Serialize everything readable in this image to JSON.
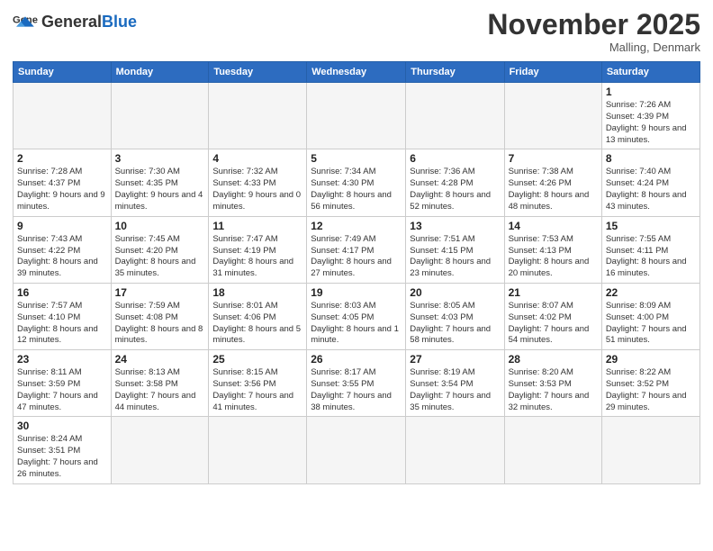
{
  "logo": {
    "general": "General",
    "blue": "Blue"
  },
  "header": {
    "month": "November 2025",
    "location": "Malling, Denmark"
  },
  "weekdays": [
    "Sunday",
    "Monday",
    "Tuesday",
    "Wednesday",
    "Thursday",
    "Friday",
    "Saturday"
  ],
  "weeks": [
    [
      {
        "day": "",
        "info": ""
      },
      {
        "day": "",
        "info": ""
      },
      {
        "day": "",
        "info": ""
      },
      {
        "day": "",
        "info": ""
      },
      {
        "day": "",
        "info": ""
      },
      {
        "day": "",
        "info": ""
      },
      {
        "day": "1",
        "info": "Sunrise: 7:26 AM\nSunset: 4:39 PM\nDaylight: 9 hours and 13 minutes."
      }
    ],
    [
      {
        "day": "2",
        "info": "Sunrise: 7:28 AM\nSunset: 4:37 PM\nDaylight: 9 hours and 9 minutes."
      },
      {
        "day": "3",
        "info": "Sunrise: 7:30 AM\nSunset: 4:35 PM\nDaylight: 9 hours and 4 minutes."
      },
      {
        "day": "4",
        "info": "Sunrise: 7:32 AM\nSunset: 4:33 PM\nDaylight: 9 hours and 0 minutes."
      },
      {
        "day": "5",
        "info": "Sunrise: 7:34 AM\nSunset: 4:30 PM\nDaylight: 8 hours and 56 minutes."
      },
      {
        "day": "6",
        "info": "Sunrise: 7:36 AM\nSunset: 4:28 PM\nDaylight: 8 hours and 52 minutes."
      },
      {
        "day": "7",
        "info": "Sunrise: 7:38 AM\nSunset: 4:26 PM\nDaylight: 8 hours and 48 minutes."
      },
      {
        "day": "8",
        "info": "Sunrise: 7:40 AM\nSunset: 4:24 PM\nDaylight: 8 hours and 43 minutes."
      }
    ],
    [
      {
        "day": "9",
        "info": "Sunrise: 7:43 AM\nSunset: 4:22 PM\nDaylight: 8 hours and 39 minutes."
      },
      {
        "day": "10",
        "info": "Sunrise: 7:45 AM\nSunset: 4:20 PM\nDaylight: 8 hours and 35 minutes."
      },
      {
        "day": "11",
        "info": "Sunrise: 7:47 AM\nSunset: 4:19 PM\nDaylight: 8 hours and 31 minutes."
      },
      {
        "day": "12",
        "info": "Sunrise: 7:49 AM\nSunset: 4:17 PM\nDaylight: 8 hours and 27 minutes."
      },
      {
        "day": "13",
        "info": "Sunrise: 7:51 AM\nSunset: 4:15 PM\nDaylight: 8 hours and 23 minutes."
      },
      {
        "day": "14",
        "info": "Sunrise: 7:53 AM\nSunset: 4:13 PM\nDaylight: 8 hours and 20 minutes."
      },
      {
        "day": "15",
        "info": "Sunrise: 7:55 AM\nSunset: 4:11 PM\nDaylight: 8 hours and 16 minutes."
      }
    ],
    [
      {
        "day": "16",
        "info": "Sunrise: 7:57 AM\nSunset: 4:10 PM\nDaylight: 8 hours and 12 minutes."
      },
      {
        "day": "17",
        "info": "Sunrise: 7:59 AM\nSunset: 4:08 PM\nDaylight: 8 hours and 8 minutes."
      },
      {
        "day": "18",
        "info": "Sunrise: 8:01 AM\nSunset: 4:06 PM\nDaylight: 8 hours and 5 minutes."
      },
      {
        "day": "19",
        "info": "Sunrise: 8:03 AM\nSunset: 4:05 PM\nDaylight: 8 hours and 1 minute."
      },
      {
        "day": "20",
        "info": "Sunrise: 8:05 AM\nSunset: 4:03 PM\nDaylight: 7 hours and 58 minutes."
      },
      {
        "day": "21",
        "info": "Sunrise: 8:07 AM\nSunset: 4:02 PM\nDaylight: 7 hours and 54 minutes."
      },
      {
        "day": "22",
        "info": "Sunrise: 8:09 AM\nSunset: 4:00 PM\nDaylight: 7 hours and 51 minutes."
      }
    ],
    [
      {
        "day": "23",
        "info": "Sunrise: 8:11 AM\nSunset: 3:59 PM\nDaylight: 7 hours and 47 minutes."
      },
      {
        "day": "24",
        "info": "Sunrise: 8:13 AM\nSunset: 3:58 PM\nDaylight: 7 hours and 44 minutes."
      },
      {
        "day": "25",
        "info": "Sunrise: 8:15 AM\nSunset: 3:56 PM\nDaylight: 7 hours and 41 minutes."
      },
      {
        "day": "26",
        "info": "Sunrise: 8:17 AM\nSunset: 3:55 PM\nDaylight: 7 hours and 38 minutes."
      },
      {
        "day": "27",
        "info": "Sunrise: 8:19 AM\nSunset: 3:54 PM\nDaylight: 7 hours and 35 minutes."
      },
      {
        "day": "28",
        "info": "Sunrise: 8:20 AM\nSunset: 3:53 PM\nDaylight: 7 hours and 32 minutes."
      },
      {
        "day": "29",
        "info": "Sunrise: 8:22 AM\nSunset: 3:52 PM\nDaylight: 7 hours and 29 minutes."
      }
    ],
    [
      {
        "day": "30",
        "info": "Sunrise: 8:24 AM\nSunset: 3:51 PM\nDaylight: 7 hours and 26 minutes."
      },
      {
        "day": "",
        "info": ""
      },
      {
        "day": "",
        "info": ""
      },
      {
        "day": "",
        "info": ""
      },
      {
        "day": "",
        "info": ""
      },
      {
        "day": "",
        "info": ""
      },
      {
        "day": "",
        "info": ""
      }
    ]
  ]
}
